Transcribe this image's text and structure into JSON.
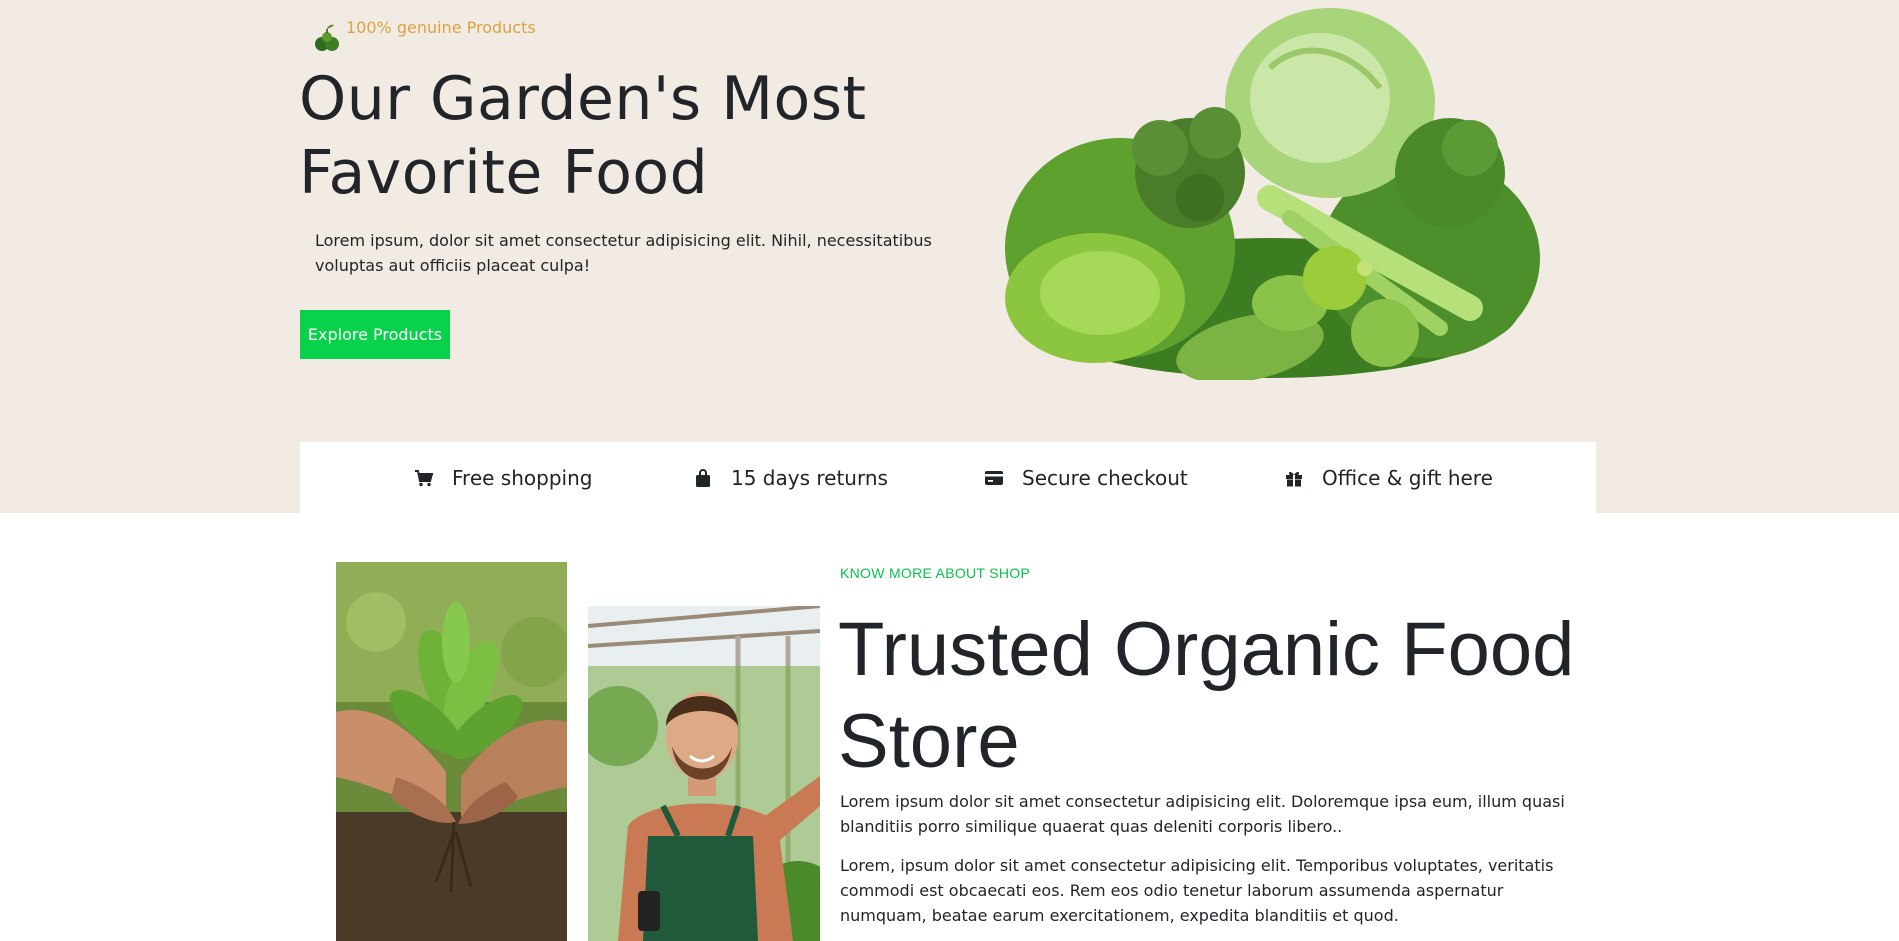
{
  "hero": {
    "badge_text": "100% genuine Products",
    "title": "Our Garden's Most Favorite Food",
    "description": "Lorem ipsum, dolor sit amet consectetur adipisicing elit. Nihil, necessitatibus voluptas aut officiis placeat culpa!",
    "cta_label": "Explore Products",
    "colors": {
      "background": "#f2ebe4",
      "badge": "#d9a441",
      "cta": "#08d24a"
    }
  },
  "features": [
    {
      "icon": "cart-icon",
      "label": "Free shopping"
    },
    {
      "icon": "bag-icon",
      "label": "15 days returns"
    },
    {
      "icon": "credit-card-icon",
      "label": "Secure checkout"
    },
    {
      "icon": "gift-icon",
      "label": "Office & gift here"
    }
  ],
  "about": {
    "kicker": "KNOW MORE ABOUT SHOP",
    "title": "Trusted Organic Food Store",
    "paragraph1": "Lorem ipsum dolor sit amet consectetur adipisicing elit. Doloremque ipsa eum, illum quasi blanditiis porro similique quaerat quas deleniti corporis libero..",
    "paragraph2": "Lorem, ipsum dolor sit amet consectetur adipisicing elit. Temporibus voluptates, veritatis commodi est obcaecati eos. Rem eos odio tenetur laborum assumenda aspernatur numquam, beatae earum exercitationem, expedita blanditiis et quod.",
    "colors": {
      "kicker": "#08c24a"
    }
  }
}
